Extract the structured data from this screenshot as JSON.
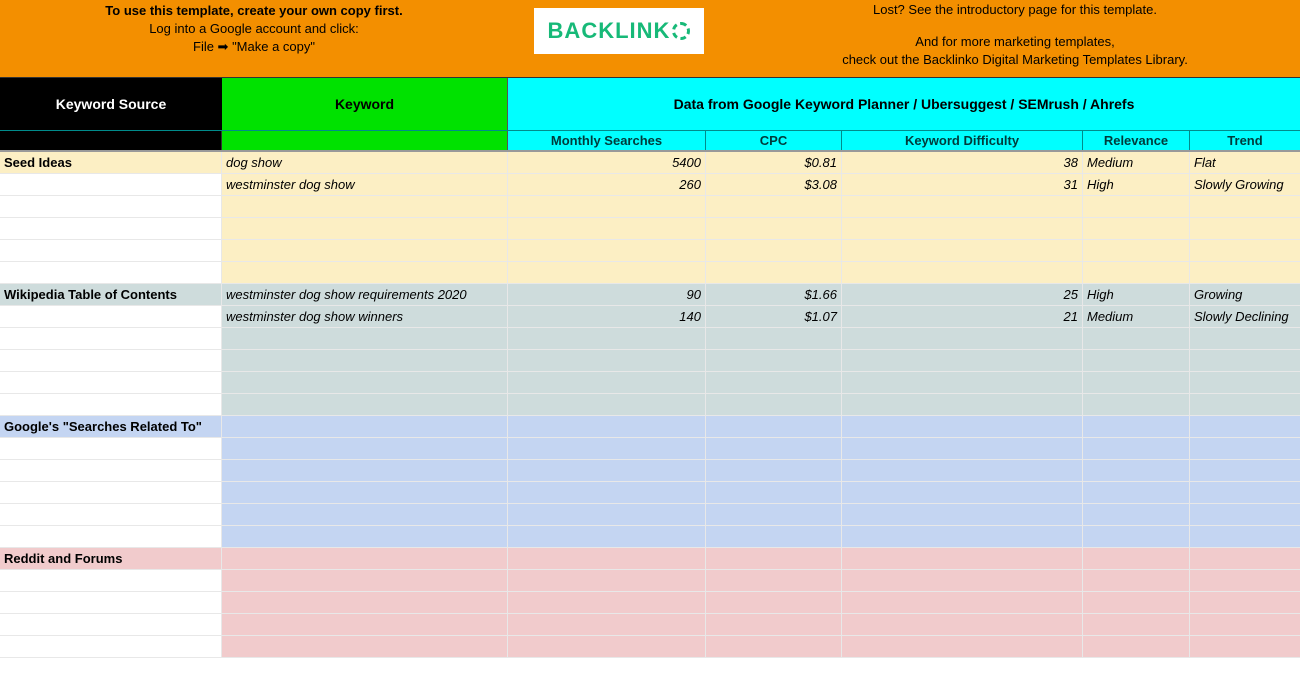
{
  "banner": {
    "left_bold": "To use this template, create your own copy first.",
    "left_line2": "Log into a Google account and click:",
    "left_line3": "File ➡ \"Make a copy\"",
    "logo_text": "BACKLINK",
    "right_line1": "Lost? See the introductory page for this template.",
    "right_line2": "And for more marketing templates,",
    "right_line3": "check out the Backlinko Digital Marketing Templates Library."
  },
  "headers": {
    "keyword_source": "Keyword Source",
    "keyword": "Keyword",
    "data_from": "Data from Google Keyword Planner / Ubersuggest / SEMrush / Ahrefs",
    "monthly_searches": "Monthly Searches",
    "cpc": "CPC",
    "keyword_difficulty": "Keyword Difficulty",
    "relevance": "Relevance",
    "trend": "Trend"
  },
  "sections": [
    {
      "name": "Seed Ideas",
      "bg": "bg-cream",
      "rows": [
        {
          "kw": "dog show",
          "ms": "5400",
          "cpc": "$0.81",
          "kd": "38",
          "rel": "Medium",
          "tr": "Flat"
        },
        {
          "kw": "westminster dog show",
          "ms": "260",
          "cpc": "$3.08",
          "kd": "31",
          "rel": "High",
          "tr": "Slowly Growing"
        },
        {},
        {},
        {},
        {}
      ]
    },
    {
      "name": "Wikipedia Table of Contents",
      "bg": "bg-slate",
      "rows": [
        {
          "kw": "westminster dog show requirements 2020",
          "ms": "90",
          "cpc": "$1.66",
          "kd": "25",
          "rel": "High",
          "tr": "Growing"
        },
        {
          "kw": "westminster dog show winners",
          "ms": "140",
          "cpc": "$1.07",
          "kd": "21",
          "rel": "Medium",
          "tr": "Slowly Declining"
        },
        {},
        {},
        {},
        {}
      ]
    },
    {
      "name": "Google's \"Searches Related To\"",
      "bg": "bg-blue",
      "rows": [
        {},
        {},
        {},
        {},
        {},
        {}
      ]
    },
    {
      "name": "Reddit and Forums",
      "bg": "bg-pink",
      "rows": [
        {},
        {},
        {},
        {},
        {}
      ]
    }
  ]
}
